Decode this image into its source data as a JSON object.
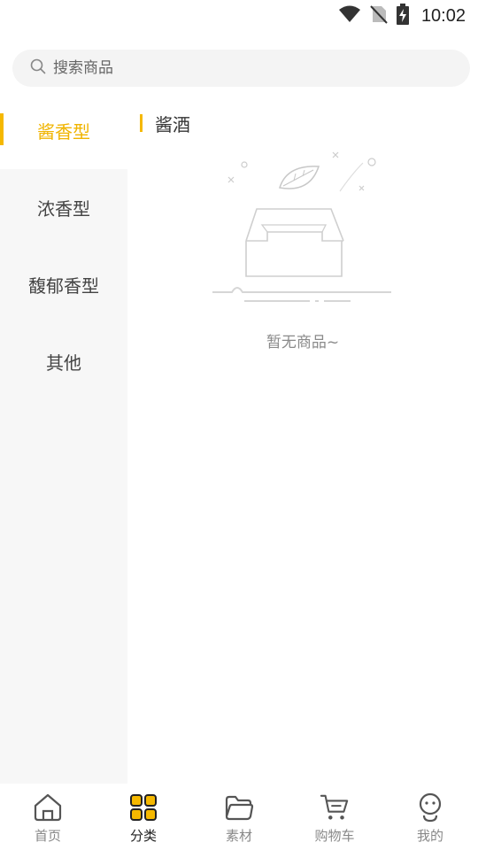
{
  "status": {
    "time": "10:02"
  },
  "search": {
    "placeholder": "搜索商品"
  },
  "sidebar": {
    "items": [
      {
        "label": "酱香型",
        "active": true
      },
      {
        "label": "浓香型",
        "active": false
      },
      {
        "label": "馥郁香型",
        "active": false
      },
      {
        "label": "其他",
        "active": false
      }
    ]
  },
  "main": {
    "section_title": "酱酒",
    "empty_text": "暂无商品~"
  },
  "tabs": [
    {
      "label": "首页",
      "icon": "home-icon",
      "active": false
    },
    {
      "label": "分类",
      "icon": "category-grid-icon",
      "active": true
    },
    {
      "label": "素材",
      "icon": "folder-icon",
      "active": false
    },
    {
      "label": "购物车",
      "icon": "cart-icon",
      "active": false
    },
    {
      "label": "我的",
      "icon": "profile-icon",
      "active": false
    }
  ],
  "colors": {
    "accent": "#f5b800",
    "sidebar_bg": "#f7f7f7",
    "search_bg": "#f4f4f4"
  }
}
